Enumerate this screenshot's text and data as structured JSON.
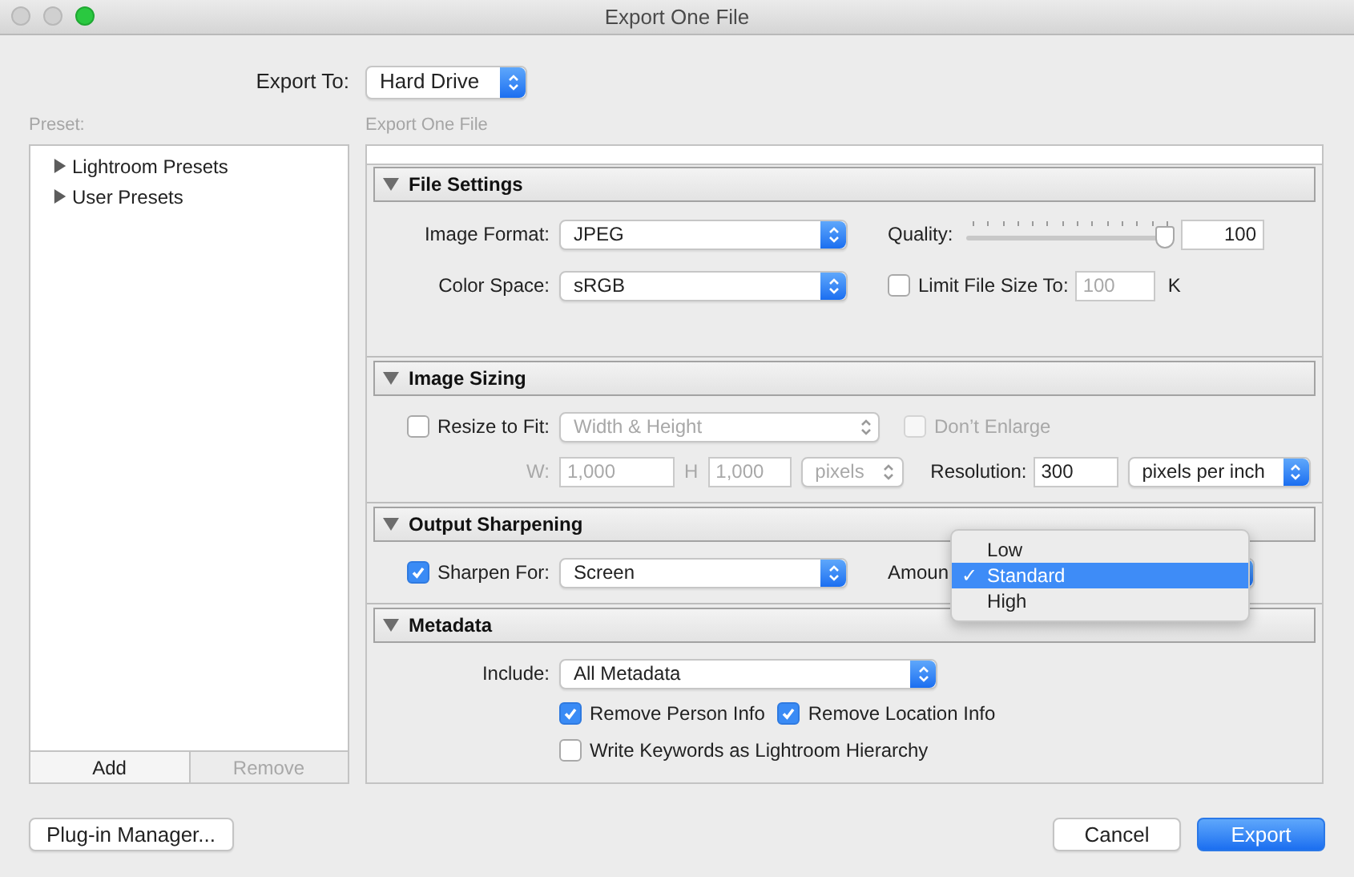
{
  "window": {
    "title": "Export One File"
  },
  "export_to": {
    "label": "Export To:",
    "value": "Hard Drive"
  },
  "preset_panel": {
    "label": "Preset:",
    "items": [
      {
        "label": "Lightroom Presets",
        "expanded": false
      },
      {
        "label": "User Presets",
        "expanded": false
      }
    ],
    "buttons": [
      {
        "label": "Add",
        "disabled": false
      },
      {
        "label": "Remove",
        "disabled": true
      }
    ]
  },
  "settings_panel": {
    "label": "Export One File",
    "file_settings": {
      "title": "File Settings",
      "expanded": true,
      "image_format": {
        "label": "Image Format:",
        "value": "JPEG"
      },
      "quality": {
        "label": "Quality:",
        "level": 1,
        "value": "100"
      },
      "color_space": {
        "label": "Color Space:",
        "value": "sRGB"
      },
      "limit_file_size": {
        "label": "Limit File Size To:",
        "checked": false,
        "value": "100",
        "unit": "K"
      }
    },
    "image_sizing": {
      "title": "Image Sizing",
      "expanded": true,
      "resize_to_fit": {
        "label": "Resize to Fit:",
        "checked": false,
        "value": "Width & Height",
        "disabled": true
      },
      "dont_enlarge": {
        "label": "Don’t Enlarge",
        "checked": false,
        "disabled": true
      },
      "width": {
        "label": "W:",
        "value": "1,000",
        "disabled": true
      },
      "height": {
        "label": "H",
        "value": "1,000",
        "disabled": true
      },
      "size_unit": {
        "value": "pixels",
        "disabled": true
      },
      "resolution": {
        "label": "Resolution:",
        "value": "300",
        "unit": "pixels per inch"
      }
    },
    "output_sharpening": {
      "title": "Output Sharpening",
      "expanded": true,
      "sharpen_for": {
        "label": "Sharpen For:",
        "checked": true,
        "value": "Screen"
      },
      "amount": {
        "label": "Amoun",
        "check_mark": "✓",
        "menu": [
          {
            "label": "Low",
            "selected": false
          },
          {
            "label": "Standard",
            "selected": true
          },
          {
            "label": "High",
            "selected": false
          }
        ]
      }
    },
    "metadata": {
      "title": "Metadata",
      "expanded": true,
      "include": {
        "label": "Include:",
        "value": "All Metadata"
      },
      "options": [
        {
          "label": "Remove Person Info",
          "checked": true
        },
        {
          "label": "Remove Location Info",
          "checked": true
        },
        {
          "label": "Write Keywords as Lightroom Hierarchy",
          "checked": false
        }
      ]
    }
  },
  "buttons": [
    {
      "label": "Plug-in Manager...",
      "primary": false
    },
    {
      "label": "Cancel",
      "primary": false
    },
    {
      "label": "Export",
      "primary": true
    }
  ]
}
